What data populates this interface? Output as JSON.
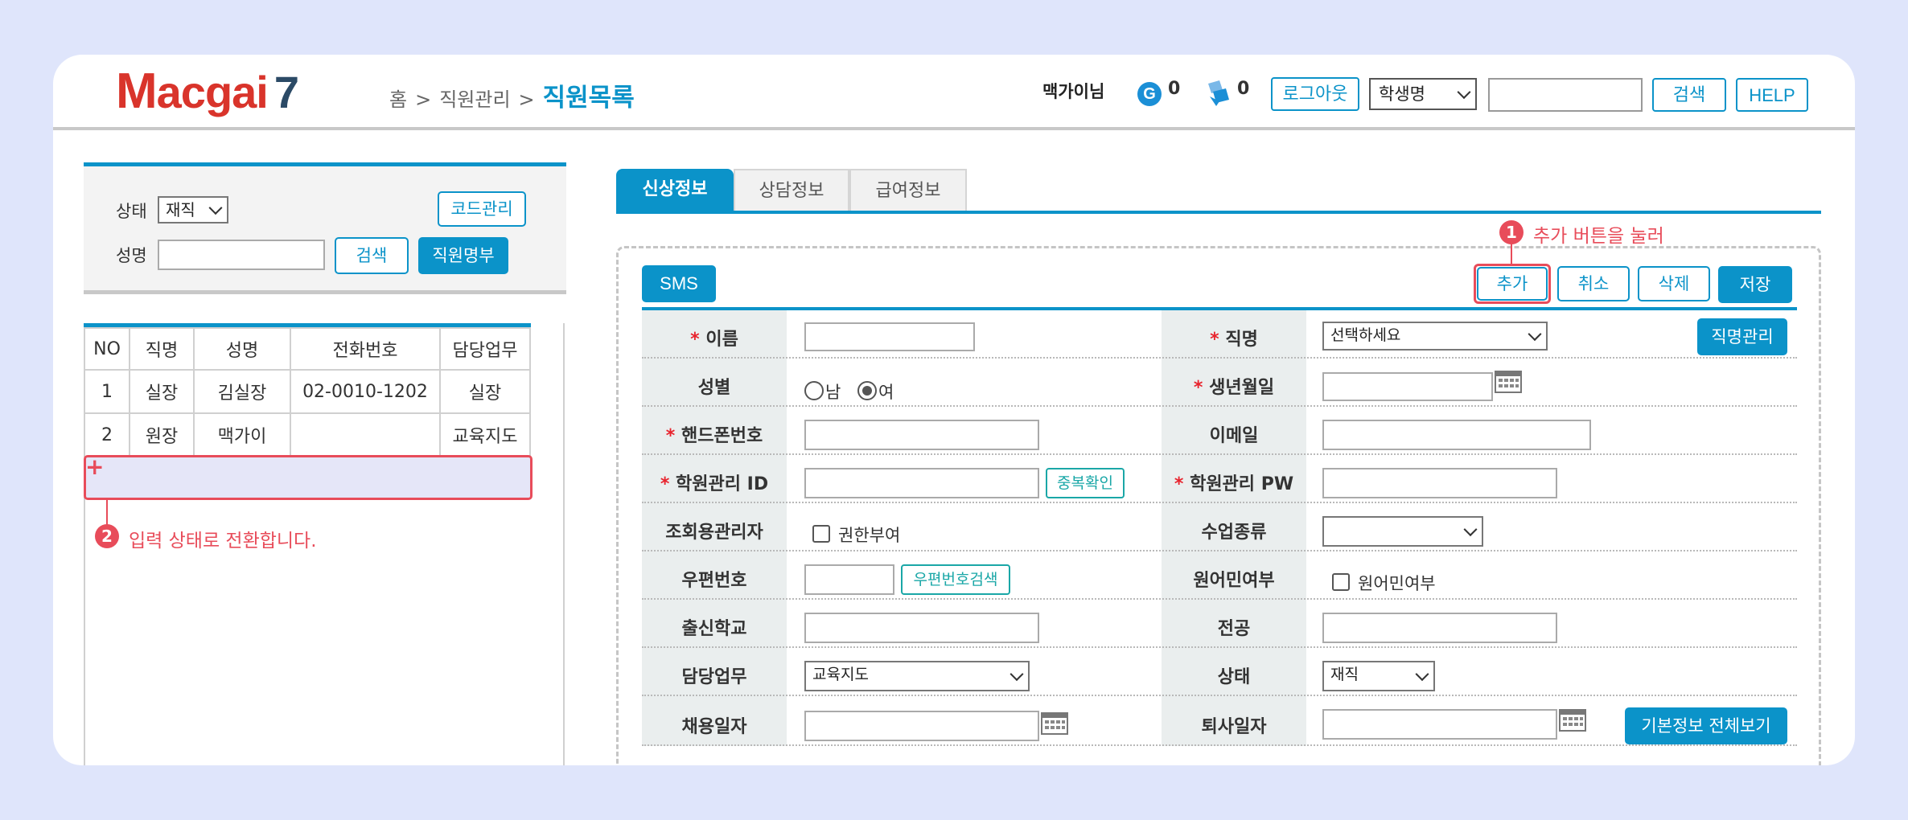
{
  "header": {
    "logo": {
      "m": "M",
      "rest": "acgai",
      "seven": "7"
    },
    "breadcrumb": {
      "home": "홈",
      "sep": ">",
      "parent": "직원관리",
      "current": "직원목록"
    },
    "user_name": "맥가이님",
    "coin_count": "0",
    "ticket_count": "0",
    "logout_label": "로그아웃",
    "search_type": "학생명",
    "search_value": "",
    "search_label": "검색",
    "help_label": "HELP",
    "colors": {
      "accent": "#0b93c9",
      "logo": "#d9342b",
      "highlight": "#e84c5a"
    }
  },
  "filter": {
    "status_label": "상태",
    "status_value": "재직",
    "name_label": "성명",
    "name_value": "",
    "code_button": "코드관리",
    "search_button": "검색",
    "roster_button": "직원명부"
  },
  "staff_table": {
    "columns": [
      "NO",
      "직명",
      "성명",
      "전화번호",
      "담당업무"
    ],
    "rows": [
      [
        "1",
        "실장",
        "김실장",
        "02-0010-1202",
        "실장"
      ],
      [
        "2",
        "원장",
        "맥가이",
        "",
        "교육지도"
      ]
    ],
    "new_row_marker": "+"
  },
  "annotations": {
    "step1_badge": "1",
    "step1_text": "추가 버튼을 눌러",
    "step2_badge": "2",
    "step2_text": "입력 상태로 전환합니다."
  },
  "tabs": [
    {
      "label": "신상정보",
      "active": true
    },
    {
      "label": "상담정보",
      "active": false
    },
    {
      "label": "급여정보",
      "active": false
    }
  ],
  "toolbar": {
    "sms": "SMS",
    "add": "추가",
    "cancel": "취소",
    "delete": "삭제",
    "save": "저장"
  },
  "form": {
    "required_mark": "*",
    "name_label": "이름",
    "name_value": "",
    "position_label": "직명",
    "position_value": "선택하세요",
    "position_manage": "직명관리",
    "gender_label": "성별",
    "gender_male": "남",
    "gender_female": "여",
    "gender_selected": "여",
    "birth_label": "생년월일",
    "birth_value": "",
    "phone_label": "핸드폰번호",
    "phone_value": "",
    "email_label": "이메일",
    "email_value": "",
    "id_label": "학원관리 ID",
    "id_value": "",
    "id_check": "중복확인",
    "pw_label": "학원관리 PW",
    "pw_value": "",
    "viewer_label": "조회용관리자",
    "viewer_option": "권한부여",
    "class_type_label": "수업종류",
    "class_type_value": "",
    "zip_label": "우편번호",
    "zip_value": "",
    "zip_search": "우편번호검색",
    "native_label": "원어민여부",
    "native_option": "원어민여부",
    "school_label": "출신학교",
    "school_value": "",
    "major_label": "전공",
    "major_value": "",
    "duty_label": "담당업무",
    "duty_value": "교육지도",
    "status_label": "상태",
    "status_value": "재직",
    "hire_label": "채용일자",
    "hire_value": "",
    "leave_label": "퇴사일자",
    "leave_value": "",
    "view_all": "기본정보 전체보기"
  }
}
